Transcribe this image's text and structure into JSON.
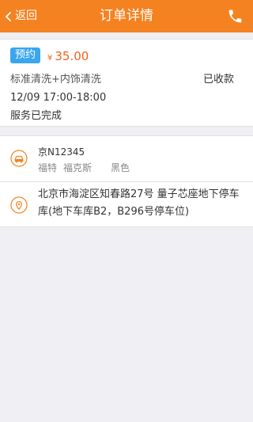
{
  "nav": {
    "back_label": "返回",
    "title": "订单详情",
    "phone_icon": "phone-icon"
  },
  "order": {
    "badge": "预约",
    "currency": "¥",
    "price": "35.00",
    "service": "标准清洗+内饰清洗",
    "payment_status": "已收款",
    "time": "12/09 17:00-18:00",
    "service_status": "服务已完成"
  },
  "car": {
    "icon": "car-icon",
    "plate": "京N12345",
    "brand": "福特",
    "model": "福克斯",
    "color": "黑色"
  },
  "location": {
    "icon": "location-pin-icon",
    "address": "北京市海淀区知春路27号 量子芯座地下停车库(地下车库B2，B296号停车位)"
  },
  "colors": {
    "nav_bg": "#f58220",
    "badge_bg": "#3aa6ef",
    "price": "#f0621c",
    "icon_accent": "#f58220",
    "page_bg": "#efeff4"
  }
}
